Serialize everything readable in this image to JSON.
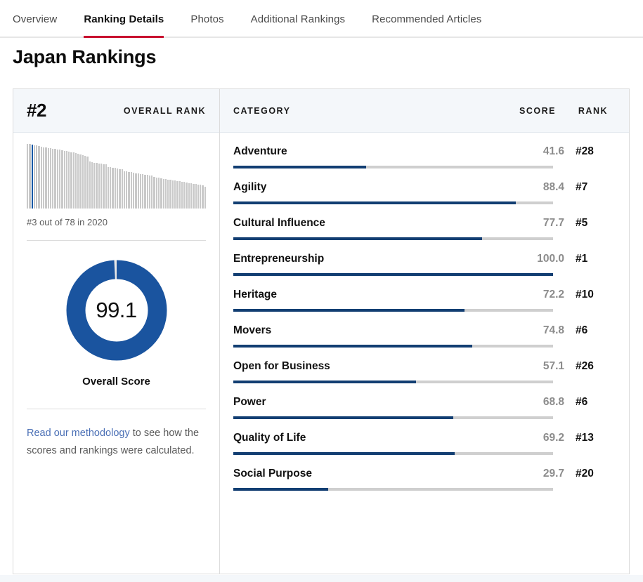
{
  "tabs": [
    {
      "label": "Overview",
      "active": false
    },
    {
      "label": "Ranking Details",
      "active": true
    },
    {
      "label": "Photos",
      "active": false
    },
    {
      "label": "Additional Rankings",
      "active": false
    },
    {
      "label": "Recommended Articles",
      "active": false
    }
  ],
  "page": {
    "title": "Japan Rankings"
  },
  "overall": {
    "rank": "#2",
    "rank_label": "OVERALL RANK",
    "sparkline_caption": "#3 out of 78 in 2020",
    "score": "99.1",
    "score_caption": "Overall Score",
    "methodology_link": "Read our methodology",
    "methodology_text": " to see how the scores and rankings were calculated."
  },
  "table": {
    "headers": {
      "category": "CATEGORY",
      "score": "SCORE",
      "rank": "RANK"
    },
    "rows": [
      {
        "category": "Adventure",
        "score": "41.6",
        "rank": "#28"
      },
      {
        "category": "Agility",
        "score": "88.4",
        "rank": "#7"
      },
      {
        "category": "Cultural Influence",
        "score": "77.7",
        "rank": "#5"
      },
      {
        "category": "Entrepreneurship",
        "score": "100.0",
        "rank": "#1"
      },
      {
        "category": "Heritage",
        "score": "72.2",
        "rank": "#10"
      },
      {
        "category": "Movers",
        "score": "74.8",
        "rank": "#6"
      },
      {
        "category": "Open for Business",
        "score": "57.1",
        "rank": "#26"
      },
      {
        "category": "Power",
        "score": "68.8",
        "rank": "#6"
      },
      {
        "category": "Quality of Life",
        "score": "69.2",
        "rank": "#13"
      },
      {
        "category": "Social Purpose",
        "score": "29.7",
        "rank": "#20"
      }
    ]
  },
  "colors": {
    "accent_red": "#c8102e",
    "bar_fill": "#123e72",
    "bar_track": "#cfcfcf",
    "donut_fill": "#1a549f",
    "header_bg": "#f4f7fa",
    "link": "#4a6fb5"
  },
  "chart_data": [
    {
      "type": "bar",
      "title": "Overall score distribution of ranked countries",
      "xlabel": "",
      "ylabel": "Overall score",
      "highlight_index": 2,
      "highlight_label": "#3 out of 78 in 2020",
      "n_bars": 78,
      "ylim": [
        0,
        100
      ],
      "values": [
        100,
        99.6,
        99.1,
        98.2,
        97.3,
        96.4,
        95.9,
        95.1,
        94.4,
        93.8,
        93.1,
        92.6,
        92.0,
        91.4,
        90.9,
        90.2,
        89.6,
        88.9,
        88.2,
        87.4,
        86.6,
        85.7,
        84.9,
        83.9,
        82.8,
        81.6,
        80.3,
        72.6,
        71.9,
        71.2,
        70.6,
        70.0,
        69.4,
        68.8,
        68.2,
        64.4,
        63.8,
        63.2,
        62.6,
        62.0,
        61.4,
        60.8,
        57.8,
        57.2,
        56.6,
        56.0,
        55.4,
        54.8,
        54.2,
        53.6,
        53.0,
        52.4,
        51.8,
        51.2,
        50.6,
        48.6,
        48.0,
        47.4,
        46.8,
        46.2,
        45.6,
        45.0,
        44.4,
        43.8,
        43.2,
        42.6,
        42.0,
        41.4,
        40.8,
        40.2,
        39.6,
        39.0,
        38.4,
        37.8,
        37.2,
        36.6,
        36.0,
        33.4
      ]
    },
    {
      "type": "pie",
      "subtype": "donut",
      "title": "Overall Score",
      "values": [
        99.1
      ],
      "max": 100,
      "center_label": "99.1",
      "legend": []
    },
    {
      "type": "bar",
      "subtype": "horizontal-progress",
      "title": "Category scores",
      "categories": [
        "Adventure",
        "Agility",
        "Cultural Influence",
        "Entrepreneurship",
        "Heritage",
        "Movers",
        "Open for Business",
        "Power",
        "Quality of Life",
        "Social Purpose"
      ],
      "values": [
        41.6,
        88.4,
        77.7,
        100.0,
        72.2,
        74.8,
        57.1,
        68.8,
        69.2,
        29.7
      ],
      "ranks": [
        28,
        7,
        5,
        1,
        10,
        6,
        26,
        6,
        13,
        20
      ],
      "xlim": [
        0,
        100
      ],
      "xlabel": "Score",
      "ylabel": ""
    }
  ]
}
